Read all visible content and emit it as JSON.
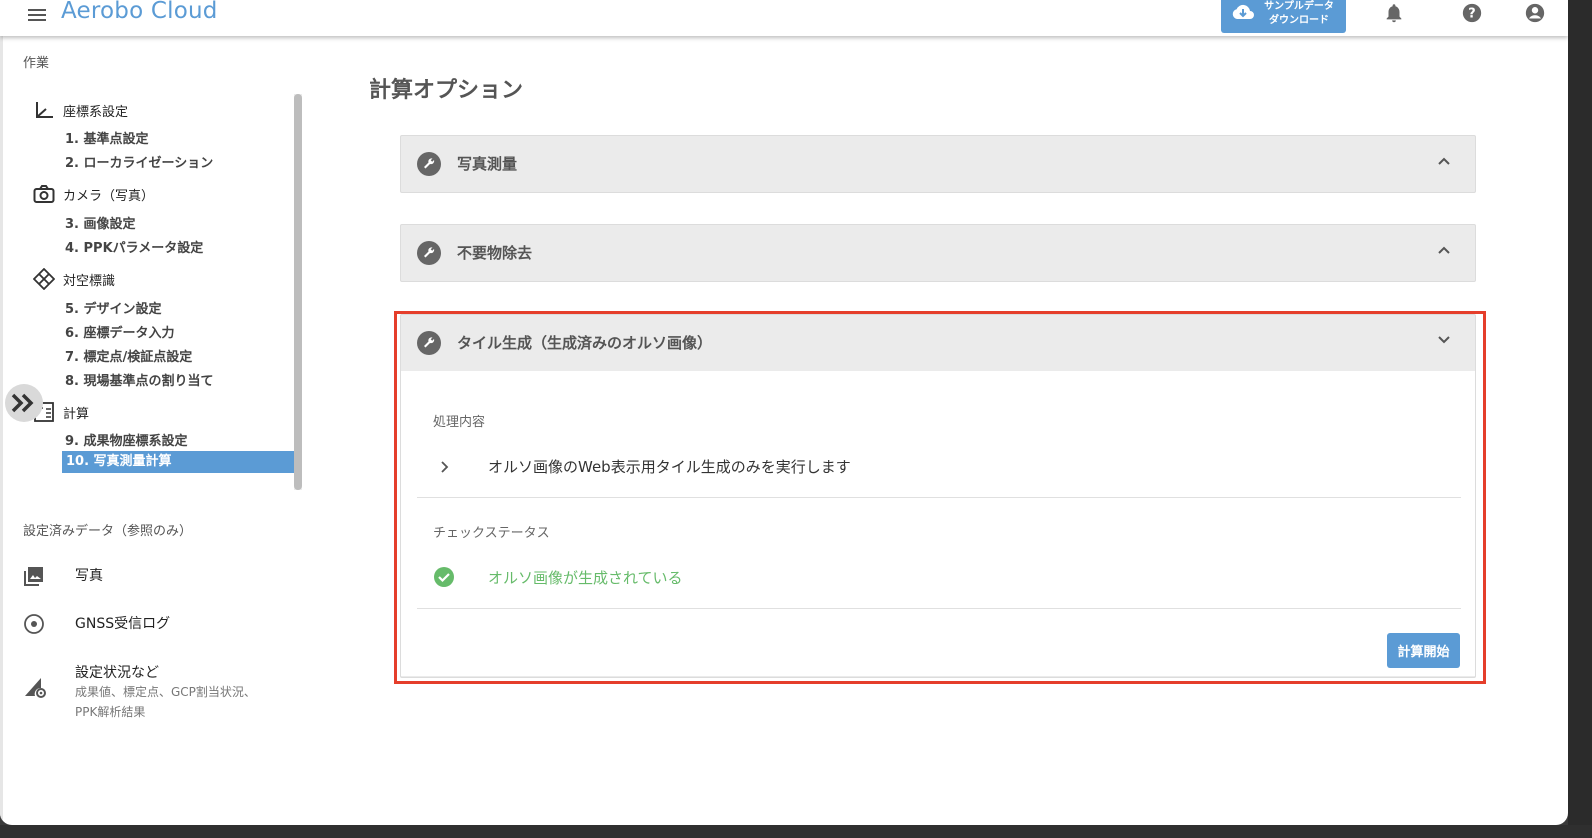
{
  "app": {
    "title": "Aerobo Cloud"
  },
  "topbar": {
    "download_label": "サンプルデータ\nダウンロード",
    "icons": [
      "cloud-download-icon",
      "bell-icon",
      "help-icon",
      "account-icon"
    ]
  },
  "sidebar": {
    "work_title": "作業",
    "groups": [
      {
        "label": "座標系設定",
        "icon": "axis-icon"
      },
      {
        "label": "カメラ（写真）",
        "icon": "camera-icon"
      },
      {
        "label": "対空標識",
        "icon": "target-diamond-icon"
      },
      {
        "label": "計算",
        "icon": "calculator-icon"
      }
    ],
    "steps": [
      "1. 基準点設定",
      "2. ローカライゼーション",
      "3. 画像設定",
      "4. PPKパラメータ設定",
      "5. デザイン設定",
      "6. 座標データ入力",
      "7. 標定点/検証点設定",
      "8. 現場基準点の割り当て",
      "9. 成果物座標系設定",
      "10. 写真測量計算"
    ],
    "ref_title": "設定済みデータ（参照のみ）",
    "ref_items": [
      {
        "label": "写真",
        "icon": "photo-icon"
      },
      {
        "label": "GNSS受信ログ",
        "icon": "gnss-icon"
      },
      {
        "label": "設定状況など",
        "sub": "成果値、標定点、GCP割当状況、\nPPK解析結果",
        "icon": "settings-signal-icon"
      }
    ]
  },
  "main": {
    "title": "計算オプション",
    "panels": [
      {
        "title": "写真測量",
        "expanded": false
      },
      {
        "title": "不要物除去",
        "expanded": false
      },
      {
        "title": "タイル生成（生成済みのオルソ画像）",
        "expanded": true
      }
    ],
    "detail": {
      "process_label": "処理内容",
      "process_value": "オルソ画像のWeb表示用タイル生成のみを実行します",
      "status_label": "チェックステータス",
      "status_value": "オルソ画像が生成されている",
      "start_button": "計算開始"
    }
  },
  "colors": {
    "accent": "#5b9bd5",
    "success": "#66bb6a",
    "highlight": "#e53e2b"
  }
}
